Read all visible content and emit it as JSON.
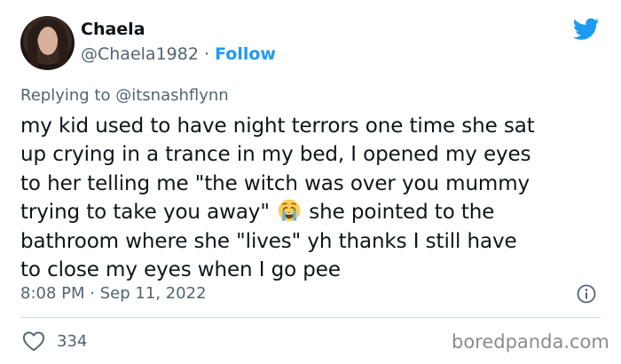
{
  "author": {
    "display_name": "Chaela",
    "handle": "@Chaela1982",
    "separator": "·",
    "follow_label": "Follow"
  },
  "reply": {
    "prefix": "Replying to",
    "mention": "@itsnashflynn"
  },
  "tweet": {
    "lines": [
      "my kid used to have night terrors one time she sat",
      "up crying in a trance in my bed, I opened my eyes",
      "to her telling me \"the witch was over you mummy",
      "trying to take you away\"",
      "she pointed to the",
      "bathroom where she \"lives\" yh thanks I still have",
      "to close my eyes when I go pee"
    ],
    "emoji": "loudly-crying-face-emoji"
  },
  "meta": {
    "time": "8:08 PM",
    "separator": "·",
    "date": "Sep 11, 2022"
  },
  "stats": {
    "likes": "334"
  },
  "watermark": "boredpanda.com",
  "colors": {
    "brand_blue": "#1d9bf0",
    "secondary_text": "#536471",
    "primary_text": "#0f1419",
    "divider": "#cfd9de"
  },
  "icons": [
    "twitter-bird-icon",
    "info-icon",
    "heart-icon"
  ]
}
